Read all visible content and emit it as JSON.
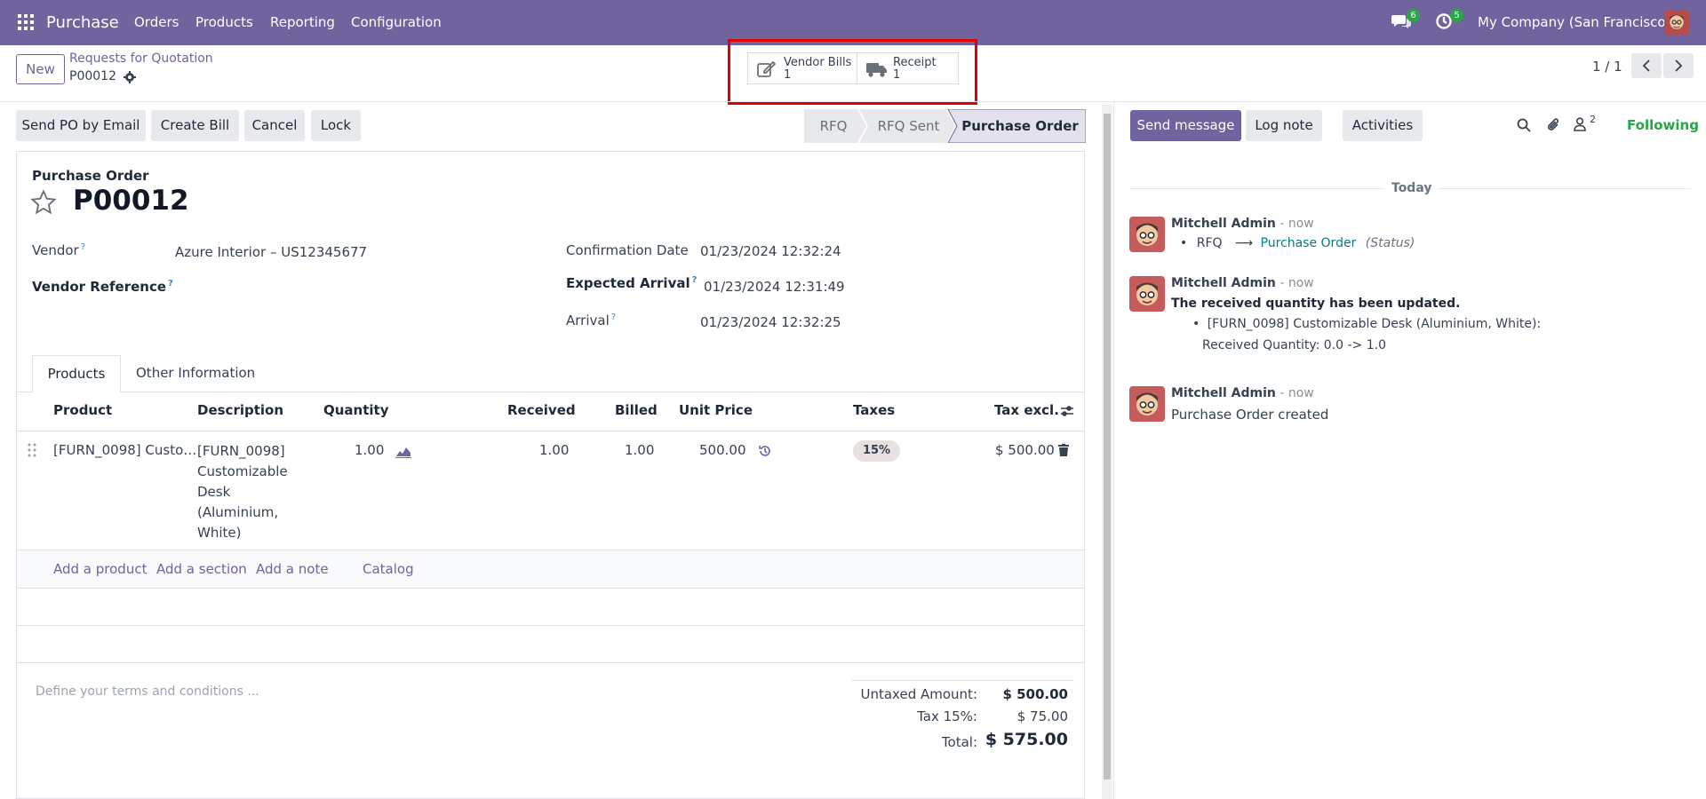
{
  "navbar": {
    "app_name": "Purchase",
    "menu": [
      "Orders",
      "Products",
      "Reporting",
      "Configuration"
    ],
    "messages_count": "6",
    "activities_count": "5",
    "company": "My Company (San Francisco)"
  },
  "control_panel": {
    "new_label": "New",
    "breadcrumb_parent": "Requests for Quotation",
    "record_name": "P00012",
    "smart_buttons": [
      {
        "label": "Vendor Bills",
        "count": "1",
        "icon": "edit-icon"
      },
      {
        "label": "Receipt",
        "count": "1",
        "icon": "truck-icon"
      }
    ],
    "pager": "1 / 1"
  },
  "actions": [
    "Send PO by Email",
    "Create Bill",
    "Cancel",
    "Lock"
  ],
  "status_steps": [
    "RFQ",
    "RFQ Sent",
    "Purchase Order"
  ],
  "form": {
    "type_label": "Purchase Order",
    "name": "P00012",
    "vendor_label": "Vendor",
    "vendor_value": "Azure Interior – US12345677",
    "vendor_ref_label": "Vendor Reference",
    "help_mark": "?",
    "confirmation_label": "Confirmation Date",
    "confirmation_value": "01/23/2024 12:32:24",
    "expected_label": "Expected Arrival",
    "expected_value": "01/23/2024 12:31:49",
    "arrival_label": "Arrival",
    "arrival_value": "01/23/2024 12:32:25"
  },
  "tabs": [
    "Products",
    "Other Information"
  ],
  "table": {
    "headers": [
      "Product",
      "Description",
      "Quantity",
      "Received",
      "Billed",
      "Unit Price",
      "Taxes",
      "Tax excl."
    ],
    "row": {
      "product": "[FURN_0098] Custo…",
      "description": [
        "[FURN_0098]",
        "Customizable",
        "Desk",
        "(Aluminium,",
        "White)"
      ],
      "quantity": "1.00",
      "received": "1.00",
      "billed": "1.00",
      "unit_price": "500.00",
      "tax": "15%",
      "subtotal": "$ 500.00"
    },
    "add_links": [
      "Add a product",
      "Add a section",
      "Add a note",
      "Catalog"
    ]
  },
  "terms_placeholder": "Define your terms and conditions ...",
  "totals": {
    "untaxed_label": "Untaxed Amount:",
    "untaxed_value": "$ 500.00",
    "tax_label": "Tax 15%:",
    "tax_value": "$ 75.00",
    "total_label": "Total:",
    "total_value": "$ 575.00"
  },
  "chatter": {
    "send_message": "Send message",
    "log_note": "Log note",
    "activities": "Activities",
    "followers_count": "2",
    "following": "Following",
    "date_separator": "Today",
    "messages": [
      {
        "author": "Mitchell Admin",
        "time": "- now",
        "from": "RFQ",
        "arrow": "⟶",
        "to": "Purchase Order",
        "field": "(Status)"
      },
      {
        "author": "Mitchell Admin",
        "time": "- now",
        "title": "The received quantity has been updated.",
        "line1": "[FURN_0098] Customizable Desk (Aluminium, White):",
        "line2": "Received Quantity: 0.0 -> 1.0"
      },
      {
        "author": "Mitchell Admin",
        "time": "- now",
        "body": "Purchase Order created"
      }
    ]
  },
  "colors": {
    "brand": "#71639e",
    "badge": "#28a745",
    "highlight": "#e00000",
    "link": "#017e84"
  }
}
